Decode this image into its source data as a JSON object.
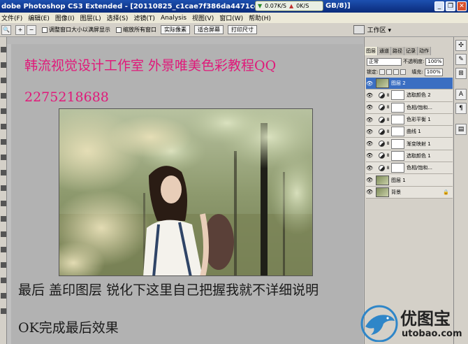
{
  "window": {
    "title": "dobe Photoshop CS3 Extended - [20110825_c1cae7f386da4471ce421lyx9HIM0sC3",
    "title_tail": "GB/8)]",
    "speed_down": "0.07K/S",
    "speed_up": "0K/S"
  },
  "menu": [
    "文件(F)",
    "编辑(E)",
    "图像(I)",
    "图层(L)",
    "选择(S)",
    "滤镜(T)",
    "Analysis",
    "视图(V)",
    "窗口(W)",
    "帮助(H)"
  ],
  "options": {
    "checkbox1": "调整窗口大小以满屏显示",
    "checkbox2": "缩放所有窗口",
    "btn_actual": "实际像素",
    "btn_fit": "适合屏幕",
    "btn_print": "打印尺寸",
    "workspace": "工作区 ▾"
  },
  "canvas_text": {
    "line1": "韩流视觉设计工作室 外景唯美色彩教程QQ",
    "line2": "2275218688",
    "line3": "最后 盖印图层 锐化下这里自己把握我就不详细说明",
    "line4": "OK完成最后效果"
  },
  "panel": {
    "tabs": [
      "图层",
      "通道",
      "路径",
      "记录",
      "动作"
    ],
    "blend_mode": "正常",
    "opacity_label": "不透明度:",
    "opacity_value": "100%",
    "lock_label": "锁定:",
    "fill_label": "填充:",
    "fill_value": "100%",
    "layers": [
      {
        "name": "图层 2",
        "kind": "pixel",
        "active": true
      },
      {
        "name": "选取颜色 2",
        "kind": "adj"
      },
      {
        "name": "色相/饱和...",
        "kind": "adj"
      },
      {
        "name": "色彩平衡 1",
        "kind": "adj"
      },
      {
        "name": "曲线 1",
        "kind": "adj"
      },
      {
        "name": "渐变映射 1",
        "kind": "adj"
      },
      {
        "name": "选取颜色 1",
        "kind": "adj"
      },
      {
        "name": "色相/饱和...",
        "kind": "adj"
      },
      {
        "name": "图层 1",
        "kind": "pixel"
      },
      {
        "name": "背景",
        "kind": "pixel",
        "locked": true
      }
    ]
  },
  "watermark": {
    "brand": "优图宝",
    "url": "utobao.com"
  },
  "colors": {
    "title_bar": "#0a2b7a",
    "pink_text": "#e0197a",
    "layer_selected": "#3a6ec2",
    "canvas_bg": "#b2b2b2"
  }
}
